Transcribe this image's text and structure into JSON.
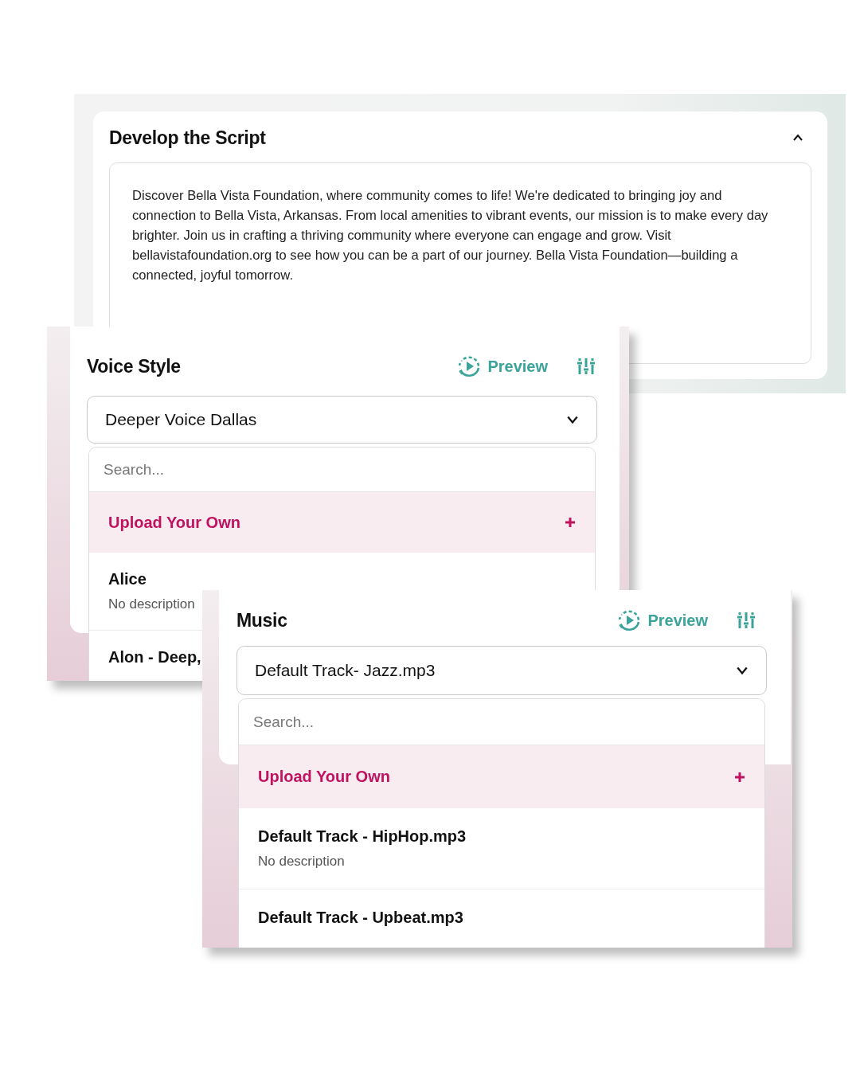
{
  "panels": [
    {
      "kind": "script",
      "title": "Develop the Script",
      "expanded": true,
      "script_text": "Discover Bella Vista Foundation, where community comes to life! We're dedicated to bringing joy and connection to Bella Vista, Arkansas. From local amenities to vibrant events, our mission is to make every day brighter. Join us in crafting a thriving community where everyone can engage and grow. Visit bellavistafoundation.org to see how you can be a part of our journey. Bella Vista Foundation—building a connected, joyful tomorrow."
    },
    {
      "kind": "picker",
      "title": "Voice Style",
      "preview": "Preview",
      "value": "Deeper Voice Dallas",
      "search": {
        "placeholder": "Search..."
      },
      "upload": "Upload Your Own",
      "options": [
        {
          "name": "Alice",
          "description": "No description"
        },
        {
          "name": "Alon - Deep,"
        }
      ]
    },
    {
      "kind": "picker",
      "title": "Music",
      "preview": "Preview",
      "value": "Default Track- Jazz.mp3",
      "search": {
        "placeholder": "Search..."
      },
      "upload": "Upload Your Own",
      "options": [
        {
          "name": "Default Track - HipHop.mp3",
          "description": "No description"
        },
        {
          "name": "Default Track - Upbeat.mp3"
        }
      ]
    }
  ]
}
